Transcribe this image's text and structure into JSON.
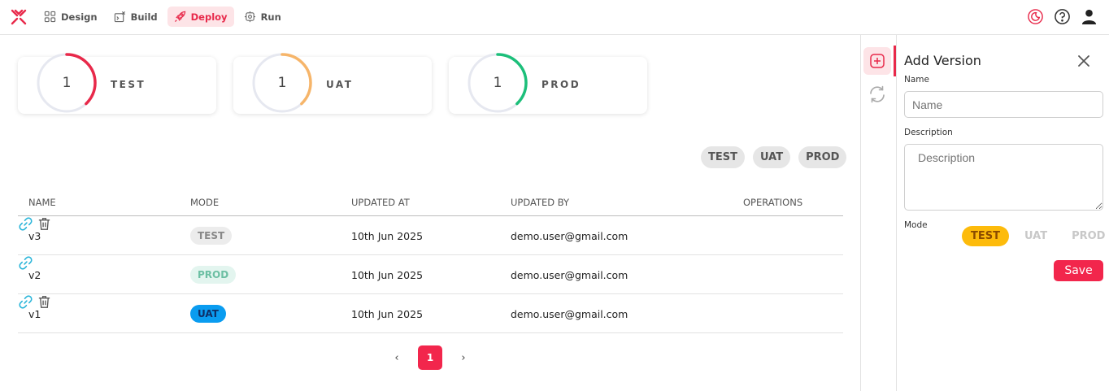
{
  "nav": {
    "items": [
      {
        "label": "Design",
        "icon": "grid-icon",
        "active": false
      },
      {
        "label": "Build",
        "icon": "build-icon",
        "active": false
      },
      {
        "label": "Deploy",
        "icon": "rocket-icon",
        "active": true
      },
      {
        "label": "Run",
        "icon": "cog-run-icon",
        "active": false
      }
    ]
  },
  "envs": [
    {
      "label": "TEST",
      "count": "1",
      "progress": 0.38,
      "color": "#e8294a"
    },
    {
      "label": "UAT",
      "count": "1",
      "progress": 0.38,
      "color": "#f6b56a"
    },
    {
      "label": "PROD",
      "count": "1",
      "progress": 0.38,
      "color": "#1cbf7a"
    }
  ],
  "filters": [
    "TEST",
    "UAT",
    "PROD"
  ],
  "table": {
    "headers": {
      "name": "NAME",
      "mode": "MODE",
      "updated_at": "UPDATED AT",
      "updated_by": "UPDATED BY",
      "operations": "OPERATIONS"
    },
    "rows": [
      {
        "name": "v3",
        "mode": "TEST",
        "updated_at": "10th Jun 2025",
        "updated_by": "demo.user@gmail.com"
      },
      {
        "name": "v2",
        "mode": "PROD",
        "updated_at": "10th Jun 2025",
        "updated_by": "demo.user@gmail.com"
      },
      {
        "name": "v1",
        "mode": "UAT",
        "updated_at": "10th Jun 2025",
        "updated_by": "demo.user@gmail.com"
      }
    ]
  },
  "pagination": {
    "current": "1",
    "prev": "‹",
    "next": "›"
  },
  "panel": {
    "title": "Add Version",
    "name_label": "Name",
    "name_placeholder": "Name",
    "desc_label": "Description",
    "desc_placeholder": "Description",
    "mode_label": "Mode",
    "modes": [
      "TEST",
      "UAT",
      "PROD"
    ],
    "selected_mode": "TEST",
    "save_label": "Save"
  },
  "colors": {
    "accent": "#f2264c",
    "uat_badge": "#0a9cf0",
    "test_selected": "#fdbb0b"
  }
}
